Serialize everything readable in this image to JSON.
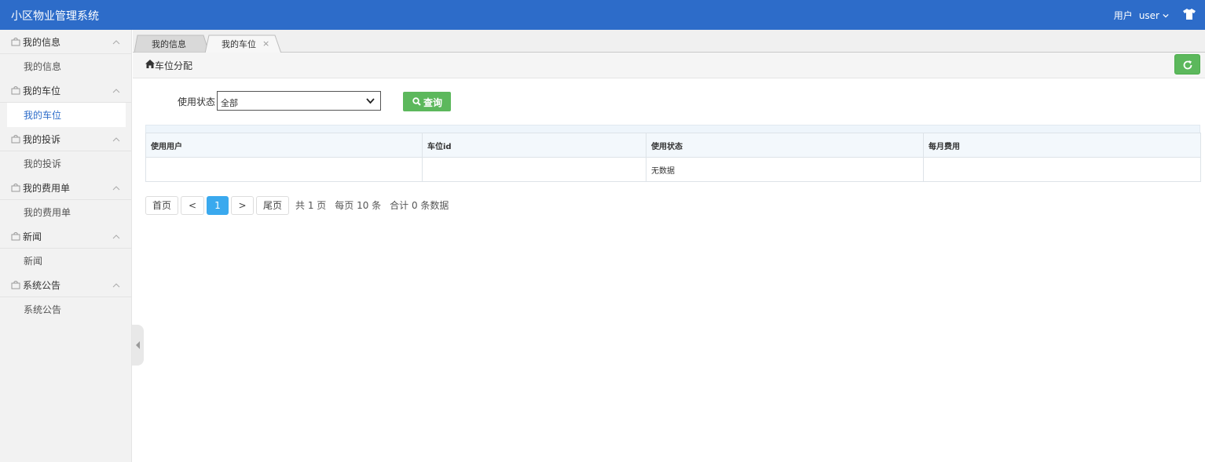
{
  "header": {
    "title": "小区物业管理系统",
    "user_role": "用户",
    "username": "user"
  },
  "sidebar": {
    "groups": [
      {
        "label": "我的信息",
        "item": "我的信息"
      },
      {
        "label": "我的车位",
        "item": "我的车位"
      },
      {
        "label": "我的投诉",
        "item": "我的投诉"
      },
      {
        "label": "我的费用单",
        "item": "我的费用单"
      },
      {
        "label": "新闻",
        "item": "新闻"
      },
      {
        "label": "系统公告",
        "item": "系统公告"
      }
    ]
  },
  "tabs": [
    {
      "label": "我的信息"
    },
    {
      "label": "我的车位",
      "close": "×"
    }
  ],
  "breadcrumb": {
    "text": "车位分配"
  },
  "filter": {
    "label": "使用状态",
    "selected": "全部",
    "query_label": "查询"
  },
  "table": {
    "columns": [
      "使用用户",
      "车位id",
      "使用状态",
      "每月费用"
    ],
    "empty_text": "无数据"
  },
  "pagination": {
    "first": "首页",
    "prev": "<",
    "current": "1",
    "next": ">",
    "last": "尾页",
    "total_pages": "共 1 页",
    "per_page": "每页 10 条",
    "total_records": "合计 0 条数据"
  },
  "colors": {
    "header_bg": "#2d6cc9",
    "accent_green": "#5cb85c",
    "active_page": "#3aa9ee"
  }
}
